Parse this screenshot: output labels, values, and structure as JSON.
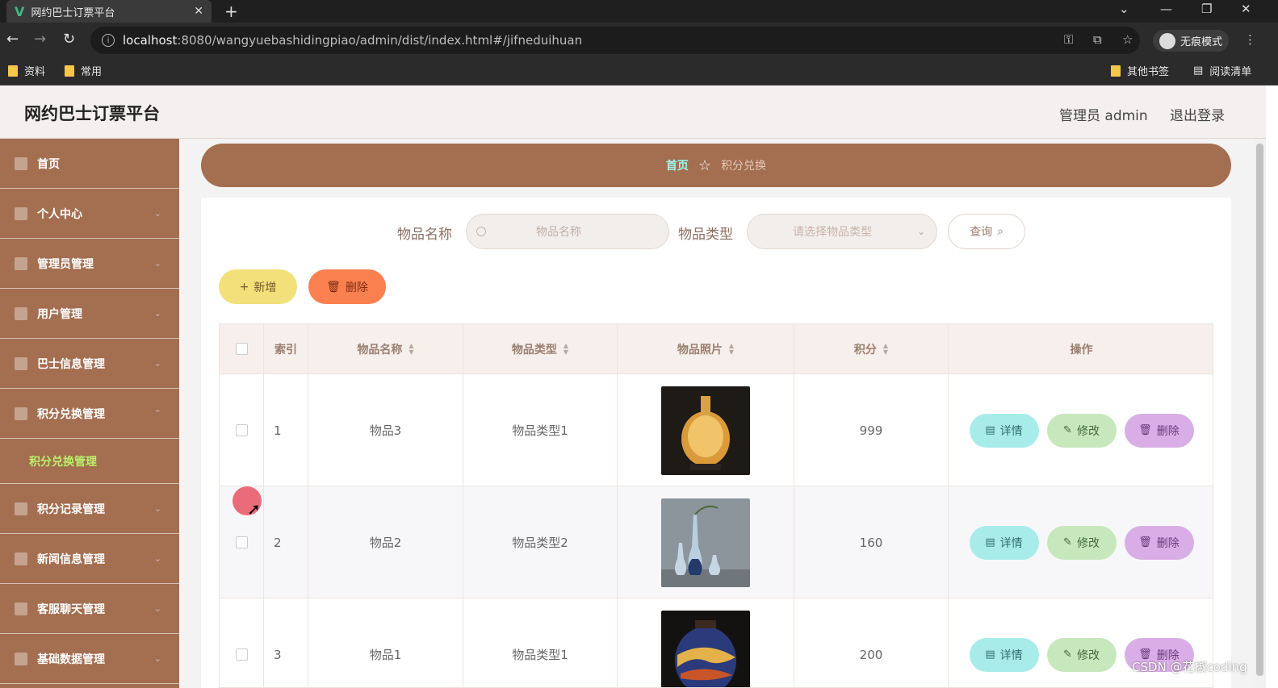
{
  "browser": {
    "tab_title": "网约巴士订票平台",
    "url_host": "localhost",
    "url_rest": ":8080/wangyuebashidingpiao/admin/dist/index.html#/jifneduihuan",
    "incognito_label": "无痕模式",
    "bookmarks": [
      "资料",
      "常用"
    ],
    "bookmarks_right": [
      "其他书签",
      "阅读清单"
    ]
  },
  "header": {
    "title": "网约巴士订票平台",
    "admin": "管理员 admin",
    "logout": "退出登录"
  },
  "sidebar": {
    "items": [
      {
        "label": "首页",
        "icon": "home-icon"
      },
      {
        "label": "个人中心",
        "icon": "user-icon"
      },
      {
        "label": "管理员管理",
        "icon": "mail-icon"
      },
      {
        "label": "用户管理",
        "icon": "user-mgmt-icon"
      },
      {
        "label": "巴士信息管理",
        "icon": "chart-icon"
      },
      {
        "label": "积分兑换管理",
        "icon": "mic-icon"
      },
      {
        "label": "积分记录管理",
        "icon": "grid-icon"
      },
      {
        "label": "新闻信息管理",
        "icon": "news-icon"
      },
      {
        "label": "客服聊天管理",
        "icon": "chat-icon"
      },
      {
        "label": "基础数据管理",
        "icon": "data-icon"
      }
    ],
    "active_sub": "积分兑换管理"
  },
  "breadcrumb": {
    "home": "首页",
    "current": "积分兑换"
  },
  "search": {
    "name_label": "物品名称",
    "name_placeholder": "物品名称",
    "type_label": "物品类型",
    "type_placeholder": "请选择物品类型",
    "query": "查询"
  },
  "actions": {
    "add": "新增",
    "delete": "删除"
  },
  "table": {
    "headers": [
      "索引",
      "物品名称",
      "物品类型",
      "物品照片",
      "积分",
      "操作"
    ],
    "rows": [
      {
        "index": "1",
        "name": "物品3",
        "type": "物品类型1",
        "points": "999"
      },
      {
        "index": "2",
        "name": "物品2",
        "type": "物品类型2",
        "points": "160"
      },
      {
        "index": "3",
        "name": "物品1",
        "type": "物品类型1",
        "points": "200"
      }
    ],
    "op_labels": {
      "detail": "详情",
      "edit": "修改",
      "delete": "删除"
    }
  },
  "watermark": "CSDN @花椒coding",
  "colors": {
    "sidebar_bg": "#a46e50",
    "active_sub": "#b8f06a",
    "crumb_home": "#9ff4ee",
    "add_btn": "#f2e07a",
    "delete_btn": "#fa8050"
  }
}
